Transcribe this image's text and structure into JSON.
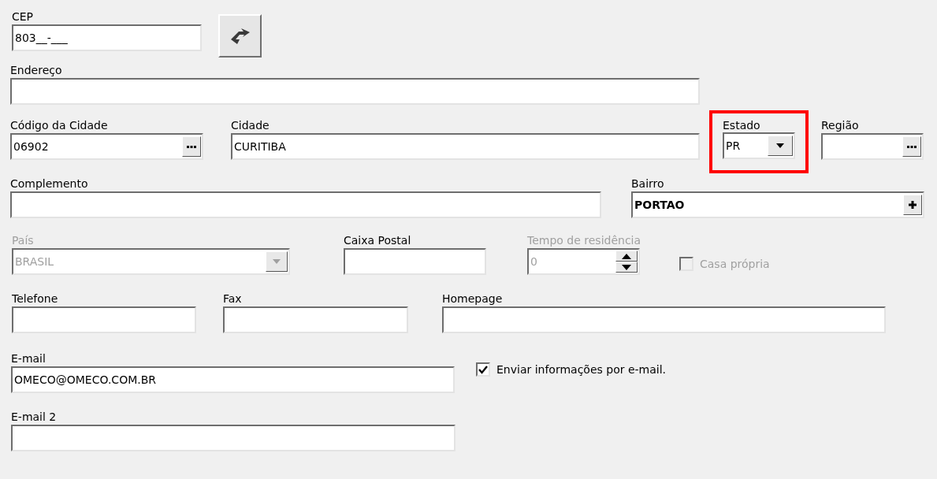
{
  "rows": [
    [
      {
        "kind": "text",
        "label": "CEP",
        "value": "803__-___",
        "disabled": false
      },
      {
        "kind": "button",
        "disabled": false
      }
    ],
    [
      {
        "kind": "text",
        "label": "Endereço",
        "disabled": false
      }
    ],
    [
      {
        "kind": "lookup",
        "label": "Código da Cidade",
        "value": "06902",
        "disabled": false
      },
      {
        "kind": "text",
        "label": "Cidade",
        "value": "CURITIBA",
        "disabled": false
      },
      {
        "kind": "combo",
        "label": "Estado",
        "value": "PR",
        "disabled": false,
        "highlighted": true
      },
      {
        "kind": "lookup",
        "label": "Região",
        "disabled": false
      }
    ],
    [
      {
        "kind": "text",
        "label": "Complemento",
        "disabled": false
      },
      {
        "kind": "lookup_add",
        "label": "Bairro",
        "value": "PORTAO",
        "disabled": false
      }
    ],
    [
      {
        "kind": "combo",
        "label": "País",
        "value": "BRASIL",
        "disabled": true,
        "highlighted": false
      },
      {
        "kind": "text",
        "label": "Caixa Postal",
        "disabled": false
      },
      {
        "kind": "spinner",
        "label": "Tempo de residência",
        "value": "0",
        "disabled": true
      },
      {
        "kind": "checkbox",
        "label": "Casa própria",
        "checked": false,
        "disabled": true
      }
    ],
    [
      {
        "kind": "text",
        "label": "Telefone",
        "disabled": false
      },
      {
        "kind": "text",
        "label": "Fax",
        "disabled": false
      },
      {
        "kind": "text",
        "label": "Homepage",
        "disabled": false
      }
    ],
    [
      {
        "kind": "text",
        "label": "E-mail",
        "value": "OMECO@OMECO.COM.BR",
        "disabled": false
      },
      {
        "kind": "checkbox",
        "label": "Enviar informações por e-mail.",
        "checked": true,
        "disabled": false
      }
    ],
    [
      {
        "kind": "text",
        "label": "E-mail 2",
        "disabled": false
      }
    ]
  ]
}
